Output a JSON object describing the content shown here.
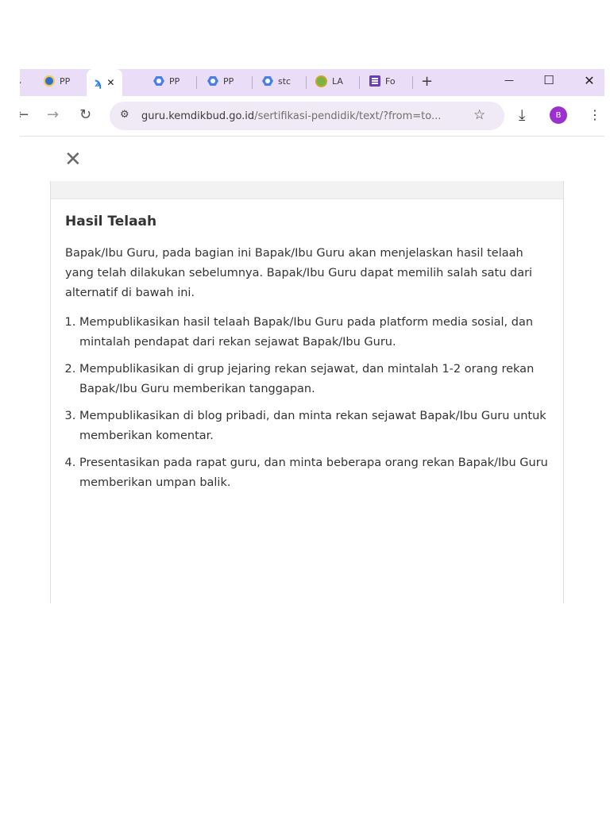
{
  "tabs": [
    {
      "label": "PP",
      "icon": "kemdikbud-icon"
    },
    {
      "label": "",
      "icon": "guru-app-icon",
      "active": true,
      "close": "✕"
    },
    {
      "label": "PP",
      "icon": "drive-icon"
    },
    {
      "label": "PP",
      "icon": "drive-icon"
    },
    {
      "label": "stc",
      "icon": "drive-icon"
    },
    {
      "label": "LA",
      "icon": "emblem-icon"
    },
    {
      "label": "Fo",
      "icon": "forms-icon"
    }
  ],
  "new_tab": "+",
  "window": {
    "minimize": "—",
    "maximize": "☐",
    "close": "✕"
  },
  "address_bar": {
    "url_host": "guru.kemdikbud.go.id",
    "url_path": "/sertifikasi-pendidik/text/?from=to..."
  },
  "profile_initial": "B",
  "page": {
    "close_label": "✕",
    "title": "Hasil Telaah",
    "intro": "Bapak/Ibu Guru, pada bagian ini Bapak/Ibu Guru akan menjelaskan hasil telaah yang telah dilakukan sebelumnya. Bapak/Ibu Guru dapat memilih salah satu dari alternatif di bawah ini.",
    "steps": [
      "Mempublikasikan hasil telaah Bapak/Ibu Guru pada platform media sosial, dan mintalah pendapat dari rekan sejawat Bapak/Ibu Guru.",
      "Mempublikasikan di grup jejaring rekan sejawat, dan mintalah 1-2 orang rekan Bapak/Ibu Guru memberikan tanggapan.",
      "Mempublikasikan di blog pribadi, dan minta rekan sejawat Bapak/Ibu Guru untuk memberikan komentar.",
      "Presentasikan pada rapat guru, dan minta beberapa orang rekan Bapak/Ibu Guru memberikan umpan balik."
    ]
  },
  "colors": {
    "tab_strip": "#e9ddf7",
    "profile": "#9b2fd0",
    "drive_blue": "#4a7ee8"
  }
}
